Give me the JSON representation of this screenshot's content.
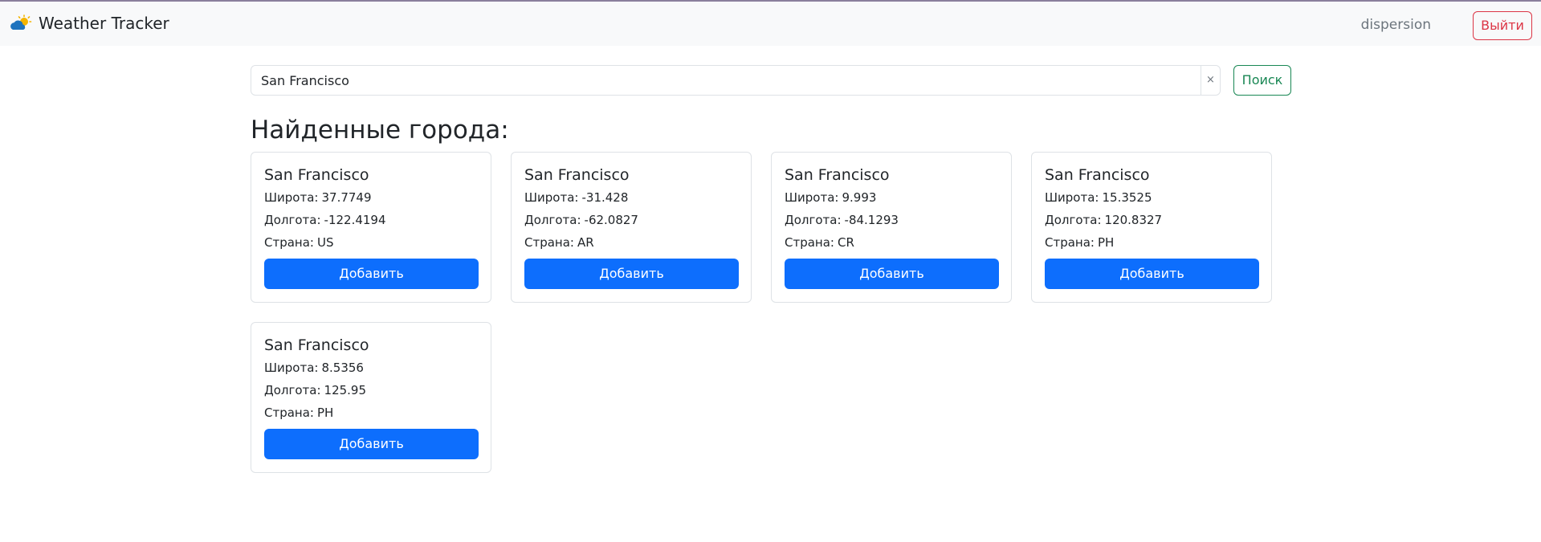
{
  "navbar": {
    "brand_text": "Weather Tracker",
    "brand_icon": "sun-behind-cloud-icon",
    "username": "dispersion",
    "logout_label": "Выйти"
  },
  "search": {
    "value": "San Francisco",
    "clear_label": "×",
    "button_label": "Поиск"
  },
  "heading": "Найденные города:",
  "labels": {
    "lat": "Широта:",
    "lon": "Долгота:",
    "country": "Страна:",
    "add": "Добавить"
  },
  "cities": [
    {
      "name": "San Francisco",
      "lat": "37.7749",
      "lon": "-122.4194",
      "country": "US"
    },
    {
      "name": "San Francisco",
      "lat": "-31.428",
      "lon": "-62.0827",
      "country": "AR"
    },
    {
      "name": "San Francisco",
      "lat": "9.993",
      "lon": "-84.1293",
      "country": "CR"
    },
    {
      "name": "San Francisco",
      "lat": "15.3525",
      "lon": "120.8327",
      "country": "PH"
    },
    {
      "name": "San Francisco",
      "lat": "8.5356",
      "lon": "125.95",
      "country": "PH"
    }
  ],
  "colors": {
    "primary": "#0d6efd",
    "success": "#198754",
    "danger": "#dc3545",
    "navbar_bg": "#f8f9fa"
  }
}
